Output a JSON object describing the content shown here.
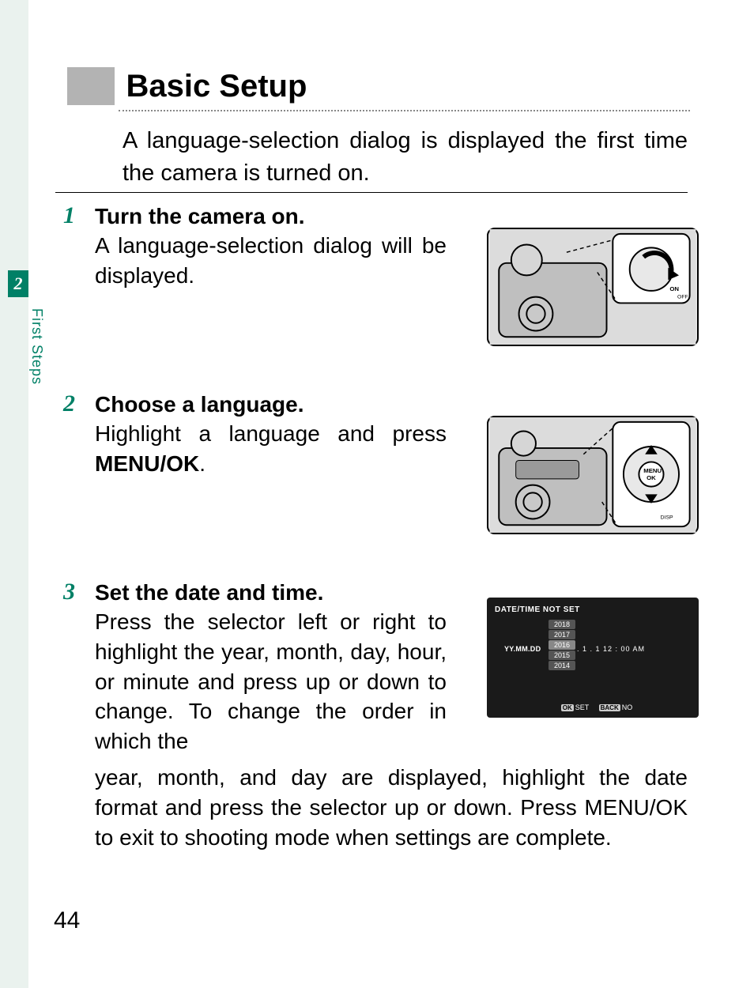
{
  "chapter": {
    "number": "2",
    "label": "First Steps"
  },
  "section": {
    "title": "Basic Setup",
    "intro": "A language-selection dialog is displayed the first time the camera is turned on."
  },
  "steps": {
    "s1": {
      "num": "1",
      "title": "Turn the camera on.",
      "body": "A language-selection dialog will be displayed.",
      "illustration": {
        "labels": {
          "on": "ON",
          "off": "OFF"
        }
      }
    },
    "s2": {
      "num": "2",
      "title": "Choose a language.",
      "body_pre": "Highlight a language and press ",
      "body_strong": "MENU/OK",
      "body_post": ".",
      "illustration": {
        "labels": {
          "menu": "MENU",
          "ok": "OK",
          "disp": "DISP"
        }
      }
    },
    "s3": {
      "num": "3",
      "title": "Set the date and time.",
      "body_col": "Press the selector left or right to highlight the year, month, day, hour, or minute and press up or down to change. To change the order in which the",
      "body_full_pre": "year, month, and day are displayed, highlight the date format and press the selector up or down. Press ",
      "body_full_strong": "MENU/OK",
      "body_full_post": " to exit to shooting mode when settings are complete."
    }
  },
  "datetime_screen": {
    "title": "DATE/TIME NOT SET",
    "years": [
      "2018",
      "2017",
      "2016",
      "2015",
      "2014"
    ],
    "selected_year": "2016",
    "format_label": "YY.MM.DD",
    "date_row": ". 1 . 1   12 : 00 AM",
    "footer": {
      "ok_btn": "OK",
      "ok_label": "SET",
      "back_btn": "BACK",
      "back_label": "NO"
    }
  },
  "page_number": "44"
}
